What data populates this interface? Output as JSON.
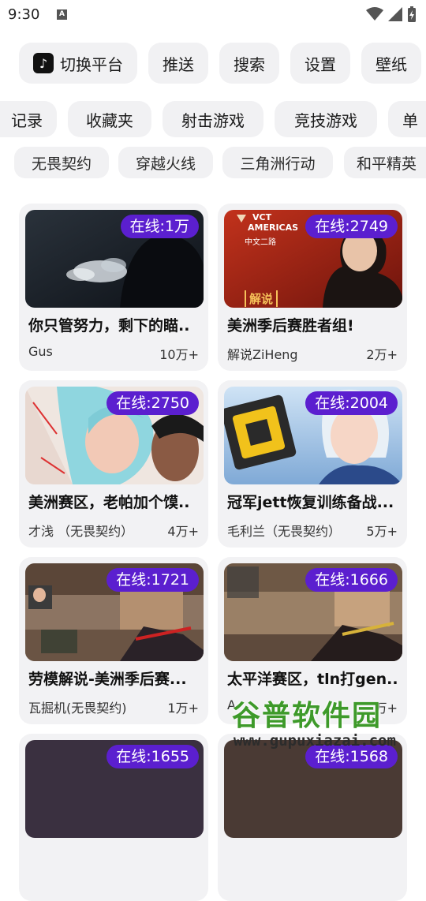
{
  "status_bar": {
    "time": "9:30",
    "a_icon": "A"
  },
  "platform_row": [
    {
      "label": "切换平台",
      "icon": "tiktok-icon"
    },
    {
      "label": "推送"
    },
    {
      "label": "搜索"
    },
    {
      "label": "设置"
    },
    {
      "label": "壁纸"
    }
  ],
  "category_row": [
    "记录",
    "收藏夹",
    "射击游戏",
    "竞技游戏",
    "单"
  ],
  "game_row": [
    "无畏契约",
    "穿越火线",
    "三角洲行动",
    "和平精英"
  ],
  "cards": [
    {
      "online": "在线:1万",
      "title": "你只管努力，剩下的瞄..",
      "author": "Gus",
      "count": "10万+"
    },
    {
      "online": "在线:2749",
      "title": "美洲季后赛胜者组!",
      "author": "解说ZiHeng",
      "count": "2万+",
      "thumb_text": [
        "VCT",
        "AMERICAS",
        "中文二路",
        "解说"
      ]
    },
    {
      "online": "在线:2750",
      "title": "美洲赛区，老帕加个馍..",
      "author": "才浅 （无畏契约）",
      "count": "4万+"
    },
    {
      "online": "在线:2004",
      "title": "冠军jett恢复训练备战...",
      "author": "毛利兰（无畏契约）",
      "count": "5万+"
    },
    {
      "online": "在线:1721",
      "title": "劳模解说-美洲季后赛...",
      "author": "瓦掘机(无畏契约)",
      "count": "1万+"
    },
    {
      "online": "在线:1666",
      "title": "太平洋赛区，tln打gen..",
      "author": "A",
      "count": "万+"
    },
    {
      "online": "在线:1655"
    },
    {
      "online": "在线:1568"
    }
  ],
  "watermark": {
    "name": "谷普软件园",
    "url": "www.gupuxiazai.com"
  },
  "colors": {
    "badge": "#5b1fcf",
    "chip_bg": "#f1f1f3",
    "card_bg": "#f2f2f4",
    "watermark_green": "#3e9a2a"
  }
}
